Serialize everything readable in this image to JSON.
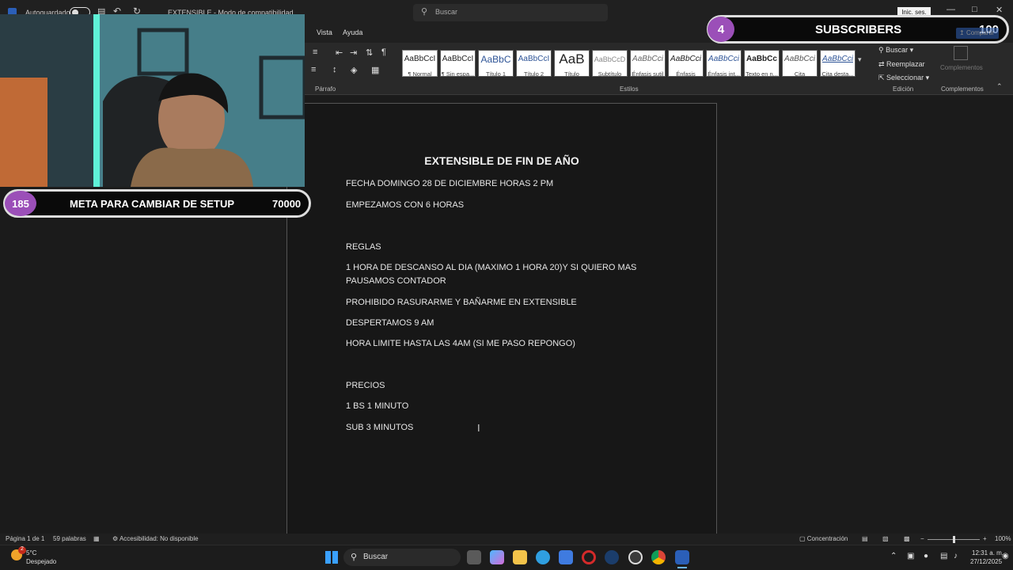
{
  "titlebar": {
    "autosave_label": "Autoguardado",
    "doc_name": "EXTENSIBLE - Modo de compatibilidad",
    "search_placeholder": "Buscar",
    "signin_label": "Inic. ses."
  },
  "menu": {
    "items": [
      "Vista",
      "Ayuda"
    ]
  },
  "ribbon": {
    "paragraph_label": "Párrafo",
    "styles_label": "Estilos",
    "edicion_label": "Edición",
    "complementos_label": "Complementos",
    "complementos_btn": "Complementos",
    "share_label": "Compartir",
    "styles": [
      {
        "preview": "AaBbCcI",
        "name": "¶ Normal"
      },
      {
        "preview": "AaBbCcI",
        "name": "¶ Sin espa..."
      },
      {
        "preview": "AaBbC",
        "name": "Título 1"
      },
      {
        "preview": "AaBbCcI",
        "name": "Título 2"
      },
      {
        "preview": "AaB",
        "name": "Título"
      },
      {
        "preview": "AaBbCcD",
        "name": "Subtítulo"
      },
      {
        "preview": "AaBbCci",
        "name": "Énfasis sutil"
      },
      {
        "preview": "AaBbCci",
        "name": "Énfasis"
      },
      {
        "preview": "AaBbCci",
        "name": "Énfasis int..."
      },
      {
        "preview": "AaBbCc",
        "name": "Texto en n..."
      },
      {
        "preview": "AaBbCci",
        "name": "Cita"
      },
      {
        "preview": "AaBbCci",
        "name": "Cita desta..."
      }
    ],
    "buscar": "Buscar",
    "reemplazar": "Reemplazar",
    "seleccionar": "Seleccionar"
  },
  "document": {
    "title": "EXTENSIBLE DE FIN DE AÑO",
    "lines": [
      "FECHA DOMINGO 28 DE DICIEMBRE HORAS 2 PM",
      "EMPEZAMOS CON 6 HORAS",
      "REGLAS",
      "1 HORA DE DESCANSO AL DIA (MAXIMO 1 HORA 20)Y SI QUIERO MAS PAUSAMOS CONTADOR",
      "PROHIBIDO RASURARME Y BAÑARME EN EXTENSIBLE",
      "DESPERTAMOS 9 AM",
      "HORA LIMITE HASTA LAS 4AM (SI ME PASO REPONGO)",
      "PRECIOS",
      "1 BS 1 MINUTO",
      "SUB 3 MINUTOS"
    ]
  },
  "overlays": {
    "subs_count": "4",
    "subs_label": "SUBSCRIBERS",
    "subs_goal": "100",
    "meta_count": "185",
    "meta_label": "META PARA CAMBIAR DE SETUP",
    "meta_goal": "70000"
  },
  "statusbar": {
    "page": "Página 1 de 1",
    "words": "59 palabras",
    "accessibility": "Accesibilidad: No disponible",
    "focus": "Concentración",
    "zoom": "100%"
  },
  "taskbar": {
    "weather_temp": "5°C",
    "weather_desc": "Despejado",
    "search": "Buscar",
    "time": "12:31 a. m.",
    "date": "27/12/2025",
    "notif_badge": "2"
  }
}
